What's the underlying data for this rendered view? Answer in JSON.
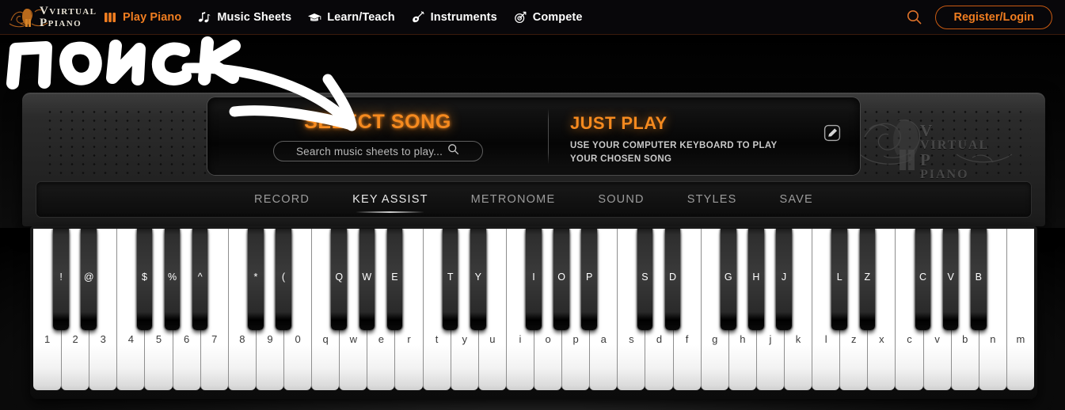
{
  "navbar": {
    "logo": {
      "line1": "VIRTUAL",
      "line2": "PIANO",
      "alt": "virtual-piano-logo"
    },
    "items": [
      {
        "label": "Play Piano",
        "icon": "piano-keys-icon",
        "active": true
      },
      {
        "label": "Music Sheets",
        "icon": "music-notes-icon",
        "active": false
      },
      {
        "label": "Learn/Teach",
        "icon": "graduation-cap-icon",
        "active": false
      },
      {
        "label": "Instruments",
        "icon": "guitar-icon",
        "active": false
      },
      {
        "label": "Compete",
        "icon": "target-icon",
        "active": false
      }
    ],
    "search_icon": "search-icon",
    "register_login_label": "Register/Login"
  },
  "display": {
    "select_song_title": "SELECT SONG",
    "search_placeholder": "Search music sheets to play...",
    "search_value": "",
    "search_icon": "search-icon",
    "just_play_title": "JUST PLAY",
    "just_play_line1": "USE YOUR COMPUTER KEYBOARD TO PLAY",
    "just_play_line2": "YOUR CHOSEN SONG",
    "edit_icon": "edit-pencil-icon"
  },
  "watermark": {
    "line1": "VIRTUAL",
    "line2": "PIANO"
  },
  "toolbar": {
    "items": [
      {
        "label": "RECORD",
        "active": false
      },
      {
        "label": "KEY ASSIST",
        "active": true
      },
      {
        "label": "METRONOME",
        "active": false
      },
      {
        "label": "SOUND",
        "active": false
      },
      {
        "label": "STYLES",
        "active": false
      },
      {
        "label": "SAVE",
        "active": false
      }
    ]
  },
  "keyboard": {
    "white_keys": [
      "1",
      "2",
      "3",
      "4",
      "5",
      "6",
      "7",
      "8",
      "9",
      "0",
      "q",
      "w",
      "e",
      "r",
      "t",
      "y",
      "u",
      "i",
      "o",
      "p",
      "a",
      "s",
      "d",
      "f",
      "g",
      "h",
      "j",
      "k",
      "l",
      "z",
      "x",
      "c",
      "v",
      "b",
      "n",
      "m"
    ],
    "black_keys": [
      {
        "label": "!",
        "after": 0
      },
      {
        "label": "@",
        "after": 1
      },
      {
        "label": "$",
        "after": 3
      },
      {
        "label": "%",
        "after": 4
      },
      {
        "label": "^",
        "after": 5
      },
      {
        "label": "*",
        "after": 7
      },
      {
        "label": "(",
        "after": 8
      },
      {
        "label": "Q",
        "after": 10
      },
      {
        "label": "W",
        "after": 11
      },
      {
        "label": "E",
        "after": 12
      },
      {
        "label": "T",
        "after": 14
      },
      {
        "label": "Y",
        "after": 15
      },
      {
        "label": "I",
        "after": 17
      },
      {
        "label": "O",
        "after": 18
      },
      {
        "label": "P",
        "after": 19
      },
      {
        "label": "S",
        "after": 21
      },
      {
        "label": "D",
        "after": 22
      },
      {
        "label": "G",
        "after": 24
      },
      {
        "label": "H",
        "after": 25
      },
      {
        "label": "J",
        "after": 26
      },
      {
        "label": "L",
        "after": 28
      },
      {
        "label": "Z",
        "after": 29
      },
      {
        "label": "C",
        "after": 31
      },
      {
        "label": "V",
        "after": 32
      },
      {
        "label": "B",
        "after": 33
      }
    ]
  },
  "annotation": {
    "text": "поиск",
    "arrow": "curved-arrow-pointing-to-search-box",
    "color": "#ffffff"
  },
  "colors": {
    "accent_orange": "#f58a1f",
    "nav_orange": "#f07d20",
    "register_border": "#c85a12",
    "background": "#000000",
    "synth_body": "#2b2b2b"
  }
}
